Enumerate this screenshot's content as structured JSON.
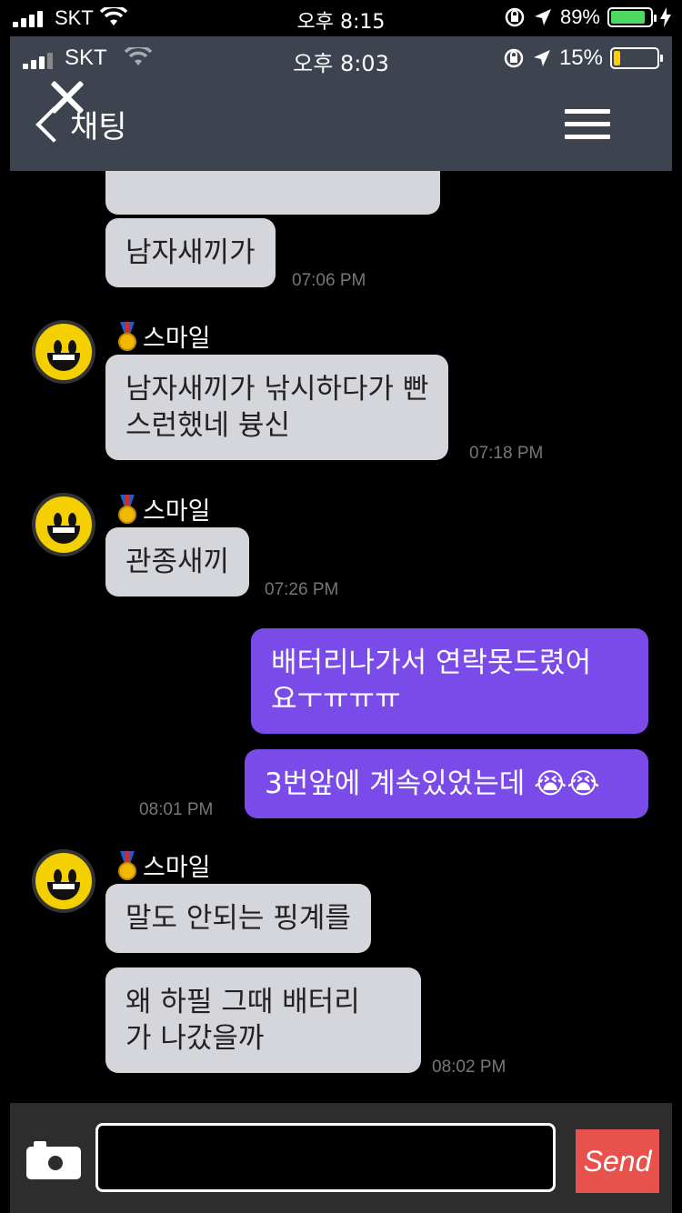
{
  "outer_status": {
    "carrier": "SKT",
    "time": "오후 8:15",
    "battery": "89%"
  },
  "inner_status": {
    "carrier": "SKT",
    "time": "오후 8:03",
    "battery": "15%"
  },
  "header": {
    "title": "채팅"
  },
  "messages": [
    {
      "text": "남자새끼가",
      "time": "07:06 PM"
    },
    {
      "sender": "스마일",
      "text": "남자새끼가 낚시하다가 빤\n스런했네 븅신",
      "time": "07:18 PM"
    },
    {
      "sender": "스마일",
      "text": "관종새끼",
      "time": "07:26 PM"
    },
    {
      "text": "배터리나가서 연락못드렸어\n요ㅜㅠㅠㅠ"
    },
    {
      "text": "3번앞에 계속있었는데 😭😭",
      "time": "08:01 PM"
    },
    {
      "sender": "스마일",
      "text": "말도 안되는 핑계를"
    },
    {
      "text": "왜 하필 그때 배터리\n가 나갔을까",
      "time": "08:02 PM"
    }
  ],
  "composer": {
    "placeholder": "",
    "send_label": "Send"
  }
}
